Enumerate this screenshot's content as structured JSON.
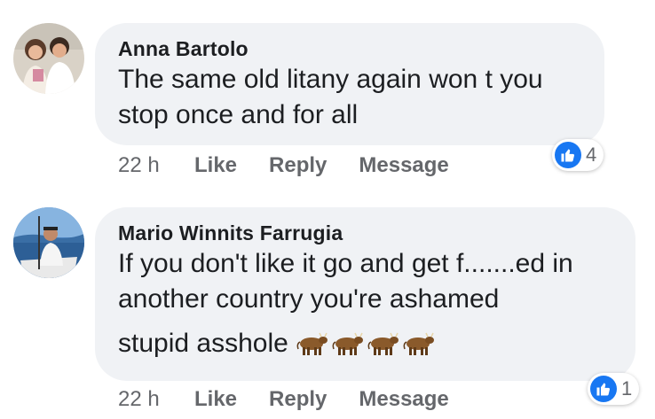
{
  "comments": [
    {
      "author": "Anna Bartolo",
      "text_line1": "The same  old litany again won t you",
      "text_line2": "stop once and for all",
      "time": "22 h",
      "like_label": "Like",
      "reply_label": "Reply",
      "message_label": "Message",
      "reaction_count": "4",
      "reaction_icon": "thumbs-up-icon",
      "avatar_icon": "two-children-photo"
    },
    {
      "author": "Mario Winnits Farrugia",
      "text_line1": "If you don't like it go and get f.......ed in",
      "text_line2": "another country you're ashamed",
      "text_line3": "stupid asshole",
      "emoji": "ox-emoji x4",
      "time": "22 h",
      "like_label": "Like",
      "reply_label": "Reply",
      "message_label": "Message",
      "reaction_count": "1",
      "reaction_icon": "thumbs-up-icon",
      "avatar_icon": "man-on-boat-photo"
    }
  ],
  "colors": {
    "bubble_bg": "#f0f2f5",
    "meta_text": "#65676b",
    "like_blue": "#1877f2"
  }
}
